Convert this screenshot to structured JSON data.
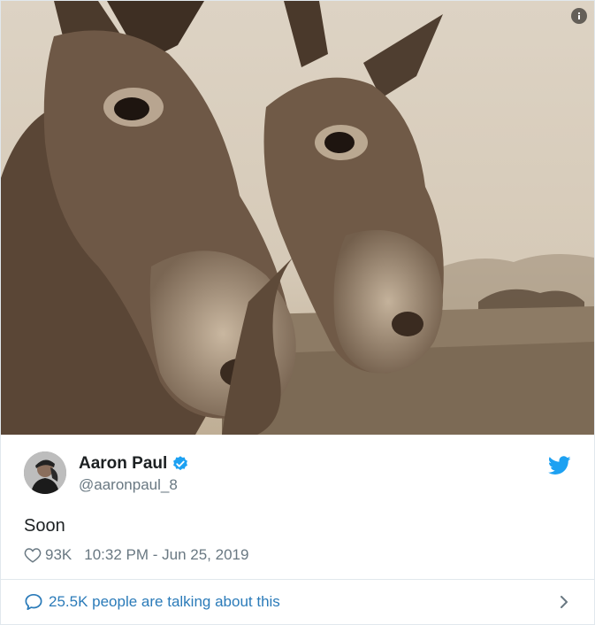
{
  "media": {
    "alt": "Two donkeys",
    "info_icon": "info-icon"
  },
  "author": {
    "display_name": "Aaron Paul",
    "handle": "@aaronpaul_8",
    "verified_icon": "verified-badge-icon",
    "avatar_icon": "avatar"
  },
  "brand": {
    "logo_icon": "twitter-bird-icon",
    "accent": "#1da1f2",
    "link_color": "#2b7bb9",
    "muted": "#697882"
  },
  "tweet": {
    "text": "Soon",
    "like_count": "93K",
    "timestamp": "10:32 PM - Jun 25, 2019"
  },
  "footer": {
    "conversation_text": "25.5K people are talking about this",
    "chevron_icon": "chevron-right-icon",
    "bubble_icon": "speech-bubble-icon"
  }
}
